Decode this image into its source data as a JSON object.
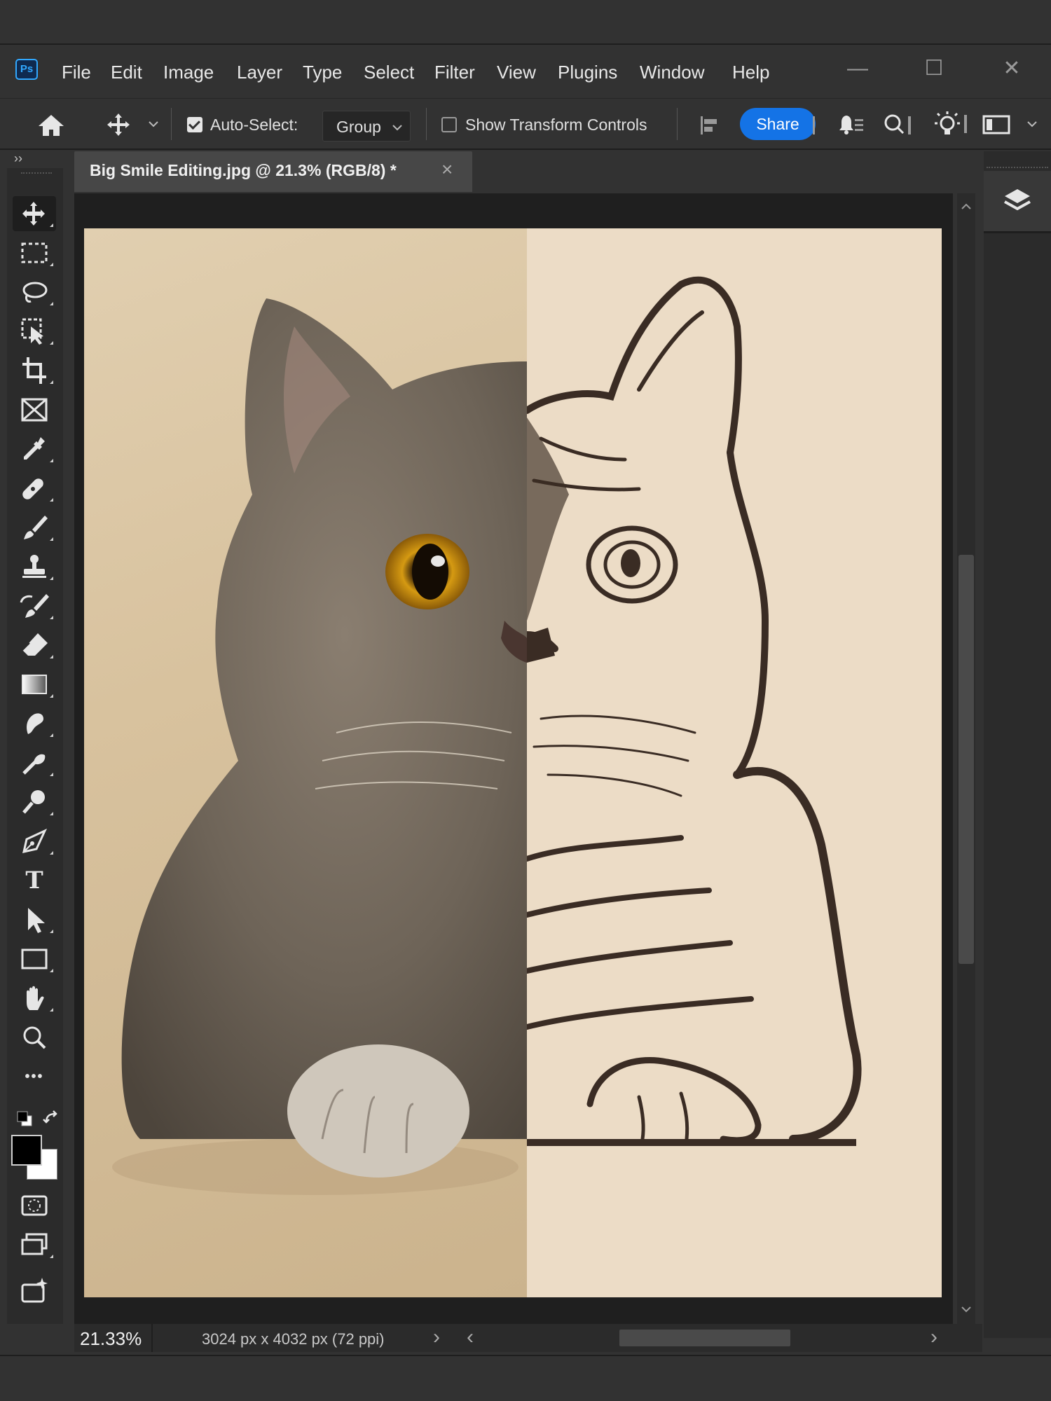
{
  "app": {
    "logo_text": "Ps"
  },
  "menu": [
    "File",
    "Edit",
    "Image",
    "Layer",
    "Type",
    "Select",
    "Filter",
    "View",
    "Plugins",
    "Window",
    "Help"
  ],
  "window_controls": {
    "minimize": "—",
    "maximize": "☐",
    "close": "✕"
  },
  "options_bar": {
    "auto_select_label": "Auto-Select:",
    "auto_select_checked": true,
    "auto_select_target": "Group",
    "show_transform_label": "Show Transform Controls",
    "show_transform_checked": false,
    "share_label": "Share"
  },
  "panel_collapse": {
    "left": "››",
    "right": "‹‹"
  },
  "document": {
    "tab_title": "Big Smile Editing.jpg @ 21.3% (RGB/8) *",
    "close_glyph": "×"
  },
  "status": {
    "zoom": "21.33%",
    "dimensions": "3024 px x 4032 px (72 ppi)",
    "arrow": "›",
    "h_scroll_left": "‹",
    "h_scroll_right": "›"
  },
  "tools": [
    "move-tool-icon",
    "marquee-tool-icon",
    "lasso-tool-icon",
    "object-selection-tool-icon",
    "crop-tool-icon",
    "frame-tool-icon",
    "eyedropper-tool-icon",
    "healing-brush-tool-icon",
    "brush-tool-icon",
    "clone-stamp-tool-icon",
    "history-brush-tool-icon",
    "eraser-tool-icon",
    "gradient-tool-icon",
    "smudge-tool-icon",
    "burn-tool-icon",
    "dodge-tool-icon",
    "pen-tool-icon",
    "type-tool-icon",
    "path-selection-tool-icon",
    "rectangle-tool-icon",
    "hand-tool-icon",
    "zoom-tool-icon",
    "more-tools-icon"
  ],
  "type_tool_glyph": "T",
  "more_tools_glyph": "•••",
  "colors": {
    "foreground": "#000000",
    "background": "#ffffff",
    "accent": "#1473e6",
    "chrome": "#323232"
  }
}
